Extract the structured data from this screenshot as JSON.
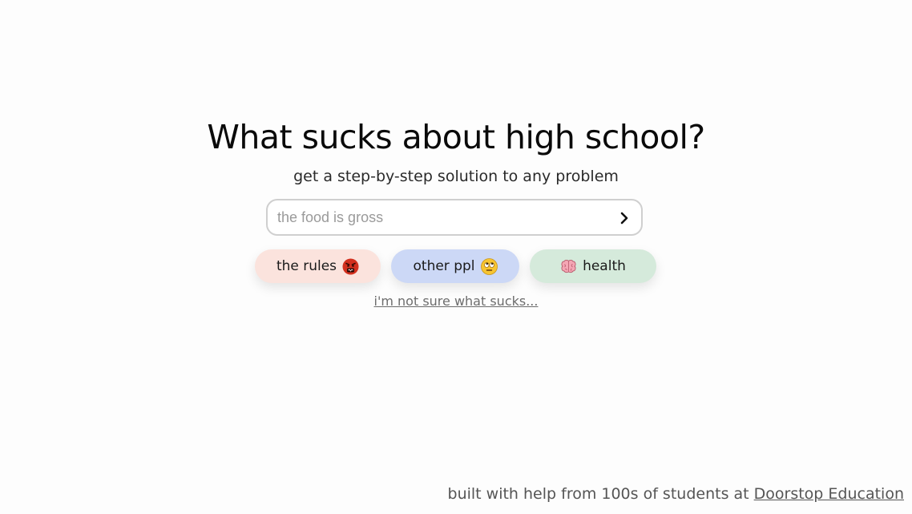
{
  "hero": {
    "title": "What sucks about high school?",
    "subtitle": "get a step-by-step solution to any problem"
  },
  "search": {
    "placeholder": "the food is gross",
    "value": "",
    "submit_icon": "chevron-right-icon"
  },
  "chips": [
    {
      "label": "the rules",
      "emoji": "angry-face-with-symbols",
      "color": "#fbe3dd"
    },
    {
      "label": "other ppl",
      "emoji": "face-with-rolling-eyes",
      "color": "#ccd8f6"
    },
    {
      "label": "health",
      "emoji": "brain",
      "color": "#d5eadb"
    }
  ],
  "unsure_link": "i'm not sure what sucks...",
  "footer": {
    "text": "built with help from 100s of students at ",
    "link": "Doorstop Education"
  }
}
